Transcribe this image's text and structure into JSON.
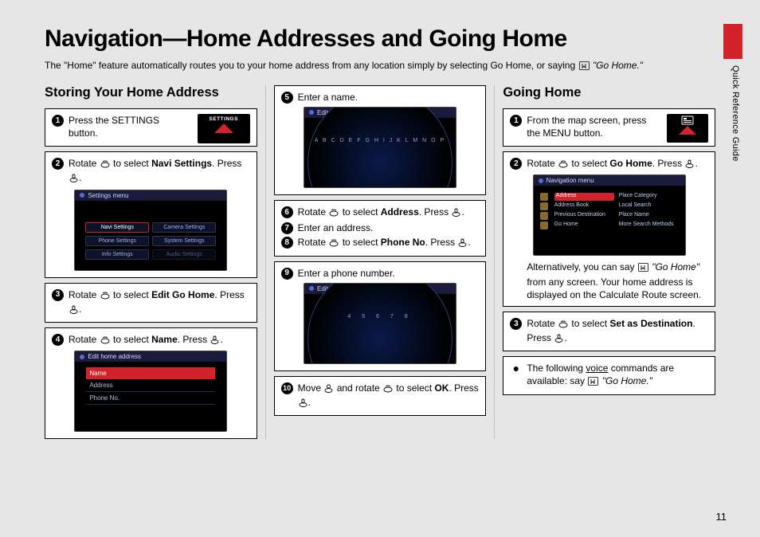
{
  "page": {
    "title": "Navigation—Home Addresses and Going Home",
    "intro_a": "The \"Home\" feature automatically routes you to your home address from any location simply by selecting Go Home, or saying ",
    "intro_voice": "\"Go Home.\"",
    "side_label": "Quick Reference Guide",
    "number": "11"
  },
  "left": {
    "heading": "Storing Your Home Address",
    "s1": "Press the SETTINGS button.",
    "s1_btn": "SETTINGS",
    "shot_menu_title": "Settings menu",
    "shot_menu_items": [
      "Navi Settings",
      "Phone Settings",
      "Info Settings",
      "Audio Settings",
      "Camera Settings",
      "System Settings"
    ],
    "s2_a": "Rotate ",
    "s2_b": " to select ",
    "s2_bold": "Navi Settings",
    "s2_c": ". Press ",
    "s2_d": ".",
    "s3_a": "Rotate ",
    "s3_b": " to select ",
    "s3_bold": "Edit Go Home",
    "s3_c": ". Press ",
    "s3_d": ".",
    "s4_a": "Rotate ",
    "s4_b": " to select ",
    "s4_bold": "Name",
    "s4_c": ". Press ",
    "s4_d": ".",
    "shot_list_title": "Edit home address",
    "shot_list_rows": [
      "Name",
      "Address",
      "Phone No."
    ]
  },
  "mid": {
    "s5": "Enter a name.",
    "shot_name_title": "Edit name",
    "dial_letters": "A B C D E F G H I J K L M N O P",
    "s6_a": "Rotate ",
    "s6_b": " to select ",
    "s6_bold": "Address",
    "s6_c": ". Press ",
    "s6_d": ".",
    "s7": "Enter an address.",
    "s8_a": "Rotate ",
    "s8_b": " to select ",
    "s8_bold": "Phone No",
    "s8_c": ". Press ",
    "s8_d": ".",
    "s9": "Enter a phone number.",
    "shot_phone_title": "Edit phone number",
    "dial_nums": "4  5  6  7  8",
    "s10_a": "Move ",
    "s10_b": " and rotate ",
    "s10_c": " to select ",
    "s10_bold": "OK",
    "s10_d": ". Press ",
    "s10_e": "."
  },
  "right": {
    "heading": "Going Home",
    "s1": "From the map screen, press the MENU button.",
    "s2_a": "Rotate ",
    "s2_b": " to select ",
    "s2_bold": "Go Home",
    "s2_c": ". Press ",
    "s2_d": ".",
    "shot_nav_title": "Navigation menu",
    "shot_nav_labels": [
      "Address",
      "Place Category",
      "Address Book",
      "Local Search",
      "Previous Destination",
      "Place Name",
      "Go Home",
      "More Search Methods"
    ],
    "alt_a": "Alternatively, you can say ",
    "alt_voice": "\"Go Home\"",
    "alt_b": " from any screen. Your home address is displayed on the Calculate Route screen.",
    "s3_a": "Rotate ",
    "s3_b": " to select ",
    "s3_bold": "Set as Destination",
    "s3_c": ". Press ",
    "s3_d": ".",
    "vc_a": "The following ",
    "vc_u": "voice",
    "vc_b": " commands are available: say ",
    "vc_voice": "\"Go Home.\""
  }
}
